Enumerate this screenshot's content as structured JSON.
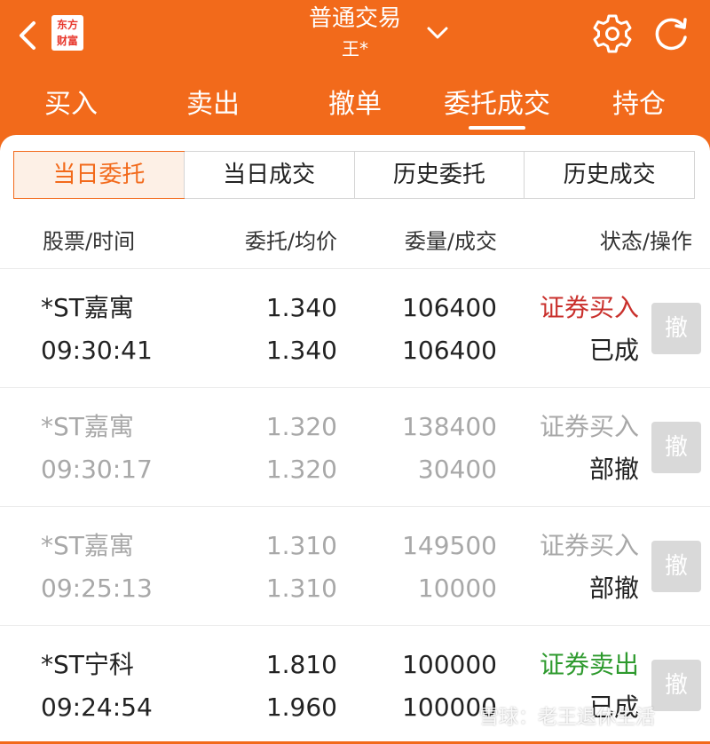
{
  "header": {
    "logo_line1": "东方",
    "logo_line2": "财富",
    "title": "普通交易",
    "account": "王*"
  },
  "tabs": [
    {
      "label": "买入"
    },
    {
      "label": "卖出"
    },
    {
      "label": "撤单"
    },
    {
      "label": "委托成交",
      "active": true
    },
    {
      "label": "持仓"
    }
  ],
  "segments": [
    {
      "label": "当日委托",
      "active": true
    },
    {
      "label": "当日成交"
    },
    {
      "label": "历史委托"
    },
    {
      "label": "历史成交"
    }
  ],
  "columns": [
    "股票/时间",
    "委托/均价",
    "委量/成交",
    "状态/操作"
  ],
  "orders": [
    {
      "name": "*ST嘉寓",
      "time": "09:30:41",
      "price": "1.340",
      "avg_price": "1.340",
      "qty": "106400",
      "filled": "106400",
      "type": "证券买入",
      "status": "已成",
      "action": "撤"
    },
    {
      "name": "*ST嘉寓",
      "time": "09:30:17",
      "price": "1.320",
      "avg_price": "1.320",
      "qty": "138400",
      "filled": "30400",
      "type": "证券买入",
      "status": "部撤",
      "action": "撤"
    },
    {
      "name": "*ST嘉寓",
      "time": "09:25:13",
      "price": "1.310",
      "avg_price": "1.310",
      "qty": "149500",
      "filled": "10000",
      "type": "证券买入",
      "status": "部撤",
      "action": "撤"
    },
    {
      "name": "*ST宁科",
      "time": "09:24:54",
      "price": "1.810",
      "avg_price": "1.960",
      "qty": "100000",
      "filled": "100000",
      "type": "证券卖出",
      "status": "已成",
      "action": "撤"
    }
  ],
  "watermark": "雪球：老王退休生活",
  "colors": {
    "brand": "#f26a1b",
    "buy": "#c9302c",
    "sell": "#2e9a2e"
  }
}
